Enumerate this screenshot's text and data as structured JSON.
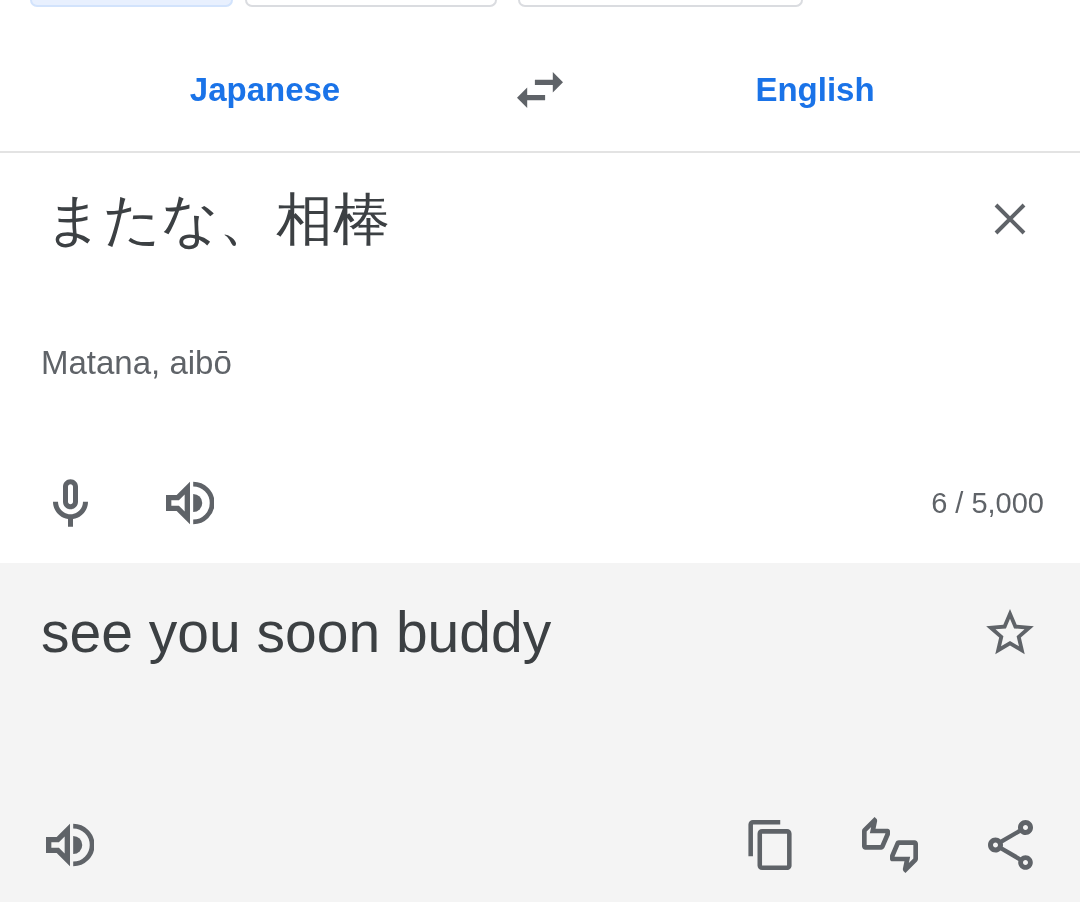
{
  "mode_chips": [
    {
      "selected": true
    },
    {
      "selected": false
    },
    {
      "selected": false
    }
  ],
  "language_bar": {
    "source": "Japanese",
    "target": "English"
  },
  "input": {
    "text": "またな、相棒",
    "transliteration": "Matana, aibō",
    "char_count": "6 / 5,000"
  },
  "output": {
    "text": "see you soon buddy",
    "starred": false
  }
}
